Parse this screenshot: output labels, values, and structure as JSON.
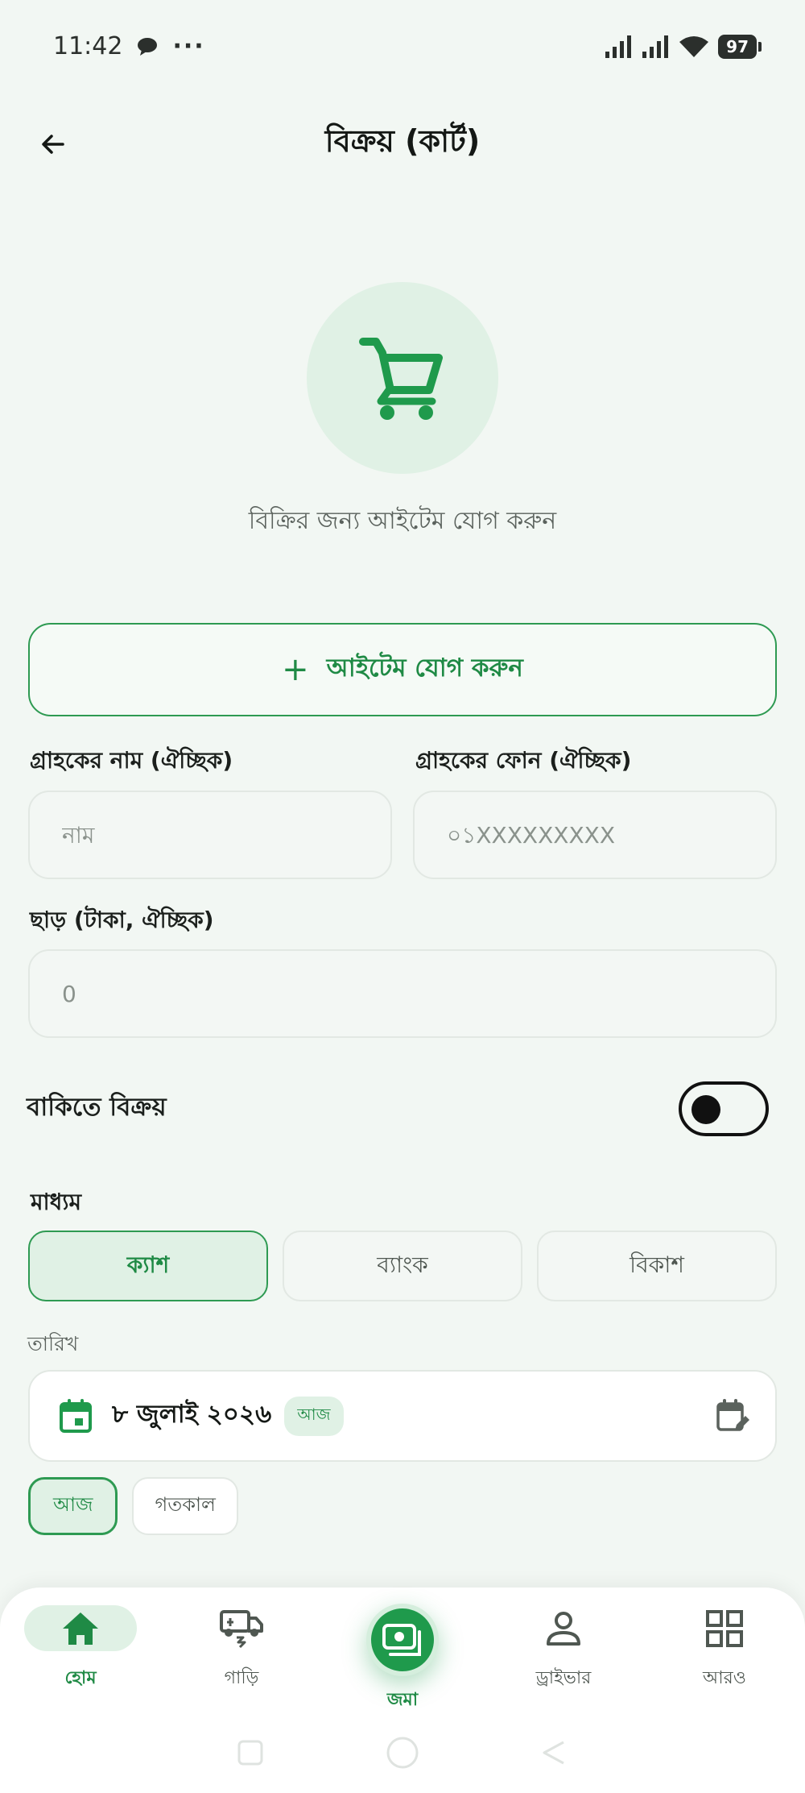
{
  "status_bar": {
    "time": "11:42",
    "dots": "···",
    "battery": "97"
  },
  "header": {
    "title": "বিক্রয় (কার্ট)"
  },
  "empty_state": {
    "text": "বিক্রির জন্য আইটেম যোগ করুন"
  },
  "add_item": {
    "label": "আইটেম যোগ করুন",
    "plus": "+"
  },
  "customer": {
    "name_label": "গ্রাহকের নাম (ঐচ্ছিক)",
    "name_placeholder": "নাম",
    "name_value": "",
    "phone_label": "গ্রাহকের ফোন (ঐচ্ছিক)",
    "phone_placeholder": "০১XXXXXXXXX",
    "phone_value": ""
  },
  "discount": {
    "label": "ছাড় (টাকা, ঐচ্ছিক)",
    "placeholder": "0",
    "value": ""
  },
  "credit_sale": {
    "label": "বাকিতে বিক্রয়",
    "enabled": false
  },
  "payment_method": {
    "label": "মাধ্যম",
    "options": [
      "ক্যাশ",
      "ব্যাংক",
      "বিকাশ"
    ],
    "selected": "ক্যাশ"
  },
  "date": {
    "label": "তারিখ",
    "value": "৮ জুলাই ২০২৬",
    "badge": "আজ",
    "quick_options": [
      "আজ",
      "গতকাল"
    ],
    "quick_selected": "আজ"
  },
  "bottom_nav": {
    "items": [
      {
        "label": "হোম",
        "icon": "home-icon",
        "active": true
      },
      {
        "label": "গাড়ি",
        "icon": "vehicle-icon",
        "active": false
      },
      {
        "label": "জমা",
        "icon": "deposit-icon",
        "active": false
      },
      {
        "label": "ড্রাইভার",
        "icon": "person-icon",
        "active": false
      },
      {
        "label": "আরও",
        "icon": "grid-icon",
        "active": false
      }
    ]
  },
  "colors": {
    "accent": "#1f9a4c",
    "accent_light": "#e0f1e5",
    "background": "#f2f7f3"
  }
}
